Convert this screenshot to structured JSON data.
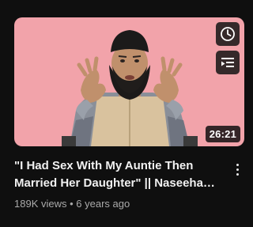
{
  "video": {
    "duration": "26:21",
    "title": "\"I Had Sex With My Auntie Then Married Her Daughter\" || Naseeha Sessions",
    "views": "189K views",
    "separator": "•",
    "age": "6 years ago"
  },
  "colors": {
    "thumbnail_background": "#f2a3aa",
    "page_background": "#0f0f0f",
    "title_text": "#f1f1f1",
    "meta_text": "#aaaaaa"
  },
  "icons": {
    "watch_later": "clock-icon",
    "add_to_queue": "queue-icon",
    "more_actions": "more-vert-icon"
  }
}
